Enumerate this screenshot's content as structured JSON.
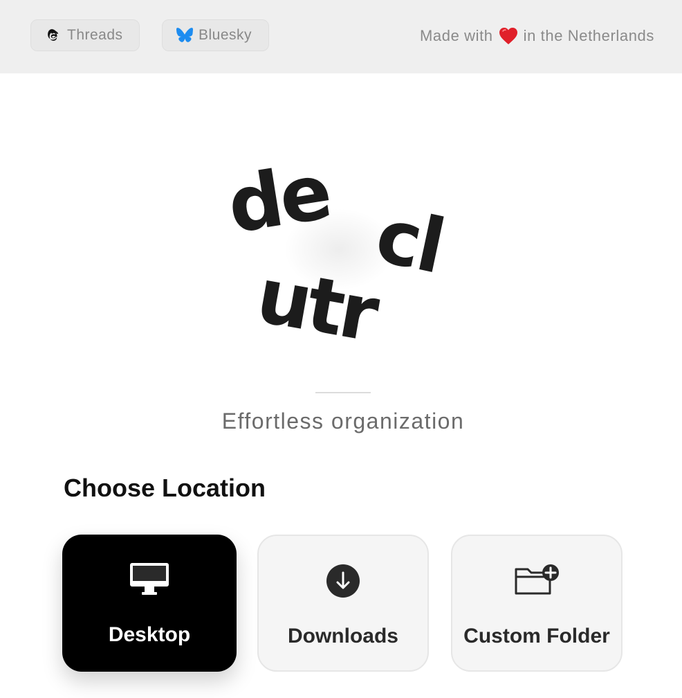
{
  "topbar": {
    "threads_label": "Threads",
    "bluesky_label": "Bluesky",
    "made_with_prefix": "Made with",
    "made_with_suffix": "in the Netherlands",
    "heart_color": "#e0202a",
    "bluesky_color": "#1d8cf0"
  },
  "logo": {
    "part1": "de",
    "part2": "cl",
    "part3": "utr"
  },
  "tagline": "Effortless organization",
  "section_title": "Choose Location",
  "locations": [
    {
      "label": "Desktop",
      "icon": "desktop-computer-icon",
      "selected": true
    },
    {
      "label": "Downloads",
      "icon": "download-arrow-icon",
      "selected": false
    },
    {
      "label": "Custom Folder",
      "icon": "folder-plus-icon",
      "selected": false
    }
  ]
}
